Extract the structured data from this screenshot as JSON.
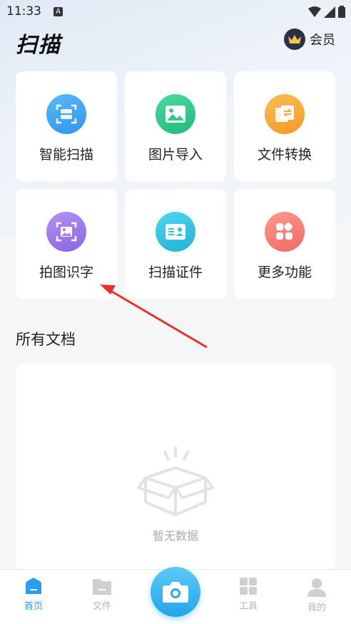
{
  "status": {
    "time": "11:33",
    "notif_letter": "A"
  },
  "header": {
    "title": "扫描",
    "vip_label": "会员"
  },
  "features": [
    {
      "label": "智能扫描",
      "icon": "scan-icon",
      "color": "#3aa6f5"
    },
    {
      "label": "图片导入",
      "icon": "image-icon",
      "color": "#2ecb8a"
    },
    {
      "label": "文件转换",
      "icon": "convert-icon",
      "color": "#f9a93a"
    },
    {
      "label": "拍图识字",
      "icon": "ocr-icon",
      "color": "#9f7bea"
    },
    {
      "label": "扫描证件",
      "icon": "id-card-icon",
      "color": "#29c4e2"
    },
    {
      "label": "更多功能",
      "icon": "more-icon",
      "color": "#f77b73"
    }
  ],
  "docs": {
    "section_title": "所有文档",
    "empty_text": "暂无数据"
  },
  "tabbar": {
    "items": [
      {
        "label": "首页",
        "icon": "home-icon",
        "active": true
      },
      {
        "label": "文件",
        "icon": "folder-icon",
        "active": false
      },
      {
        "label": "",
        "icon": "camera-icon",
        "active": false
      },
      {
        "label": "工具",
        "icon": "tools-icon",
        "active": false
      },
      {
        "label": "我的",
        "icon": "profile-icon",
        "active": false
      }
    ]
  },
  "colors": {
    "accent": "#2a9cf3",
    "annotation_arrow": "#e8332c"
  }
}
